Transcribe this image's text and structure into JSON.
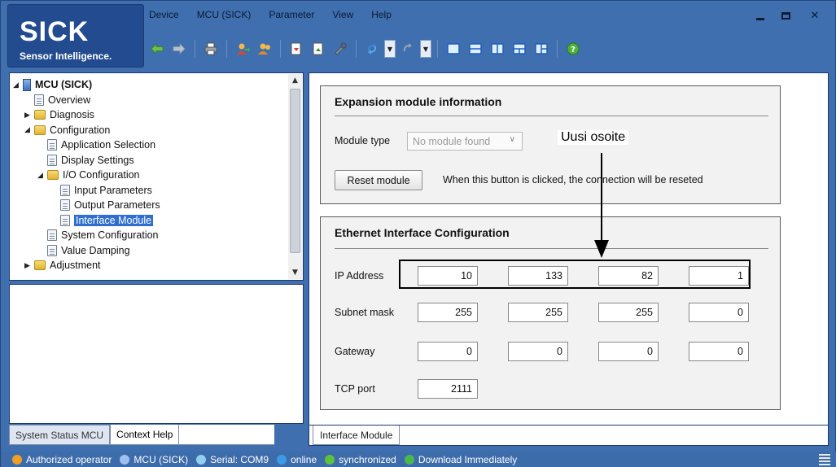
{
  "brand": {
    "name": "SICK",
    "tagline": "Sensor Intelligence."
  },
  "menu": [
    "Device",
    "MCU (SICK)",
    "Parameter",
    "View",
    "Help"
  ],
  "window_controls": [
    "minimize-icon",
    "maximize-icon",
    "close-icon"
  ],
  "toolbar_icons": [
    "back-arrow-icon",
    "forward-arrow-icon",
    "print-icon",
    "user-login-icon",
    "user-logout-icon",
    "read-icon",
    "write-icon",
    "tools-icon",
    "sync-icon",
    "sync-disabled-icon",
    "layout-single-icon",
    "layout-horizontal-icon",
    "layout-vertical-icon",
    "layout-split-icon",
    "layout-quad-icon",
    "help-icon"
  ],
  "close_glyph": "✕",
  "tree": {
    "items": [
      {
        "label": "MCU (SICK)",
        "level": 0,
        "arrow": "◢",
        "icon": "mcu"
      },
      {
        "label": "Overview",
        "level": 1,
        "arrow": "",
        "icon": "doc"
      },
      {
        "label": "Diagnosis",
        "level": 1,
        "arrow": "▶",
        "icon": "folder"
      },
      {
        "label": "Configuration",
        "level": 1,
        "arrow": "◢",
        "icon": "folder"
      },
      {
        "label": "Application Selection",
        "level": 2,
        "arrow": "",
        "icon": "doc"
      },
      {
        "label": "Display Settings",
        "level": 2,
        "arrow": "",
        "icon": "doc"
      },
      {
        "label": "I/O Configuration",
        "level": 2,
        "arrow": "◢",
        "icon": "folder"
      },
      {
        "label": "Input Parameters",
        "level": 3,
        "arrow": "",
        "icon": "doc"
      },
      {
        "label": "Output Parameters",
        "level": 3,
        "arrow": "",
        "icon": "doc"
      },
      {
        "label": "Interface Module",
        "level": 3,
        "arrow": "",
        "icon": "doc",
        "selected": true
      },
      {
        "label": "System Configuration",
        "level": 2,
        "arrow": "",
        "icon": "doc"
      },
      {
        "label": "Value Damping",
        "level": 2,
        "arrow": "",
        "icon": "doc"
      },
      {
        "label": "Adjustment",
        "level": 1,
        "arrow": "▶",
        "icon": "folder"
      }
    ]
  },
  "left_tabs": [
    "System Status MCU",
    "Context Help"
  ],
  "expansion": {
    "title": "Expansion module information",
    "module_type_label": "Module type",
    "module_type_value": "No module found",
    "reset_button": "Reset module",
    "reset_note": "When this button is clicked, the connection will be reseted"
  },
  "ethernet": {
    "title": "Ethernet Interface Configuration",
    "ip_label": "IP Address",
    "ip": [
      "10",
      "133",
      "82",
      "1"
    ],
    "subnet_label": "Subnet mask",
    "subnet": [
      "255",
      "255",
      "255",
      "0"
    ],
    "gateway_label": "Gateway",
    "gateway": [
      "0",
      "0",
      "0",
      "0"
    ],
    "tcp_label": "TCP port",
    "tcp_port": "2111"
  },
  "callout": "Uusi osoite",
  "right_tab": "Interface Module",
  "status_bar": [
    {
      "text": "Authorized operator",
      "icon": "user-icon",
      "color": "#f0a020"
    },
    {
      "text": "MCU (SICK)",
      "icon": "device-icon",
      "color": "#9fc0ee"
    },
    {
      "text": "Serial: COM9",
      "icon": "serial-icon",
      "color": "#8fd0f0"
    },
    {
      "text": "online",
      "icon": "online-icon",
      "color": "#3c9be8"
    },
    {
      "text": "synchronized",
      "icon": "check-icon",
      "color": "#5cc23a"
    },
    {
      "text": "Download Immediately",
      "icon": "download-icon",
      "color": "#4cb84c"
    }
  ]
}
